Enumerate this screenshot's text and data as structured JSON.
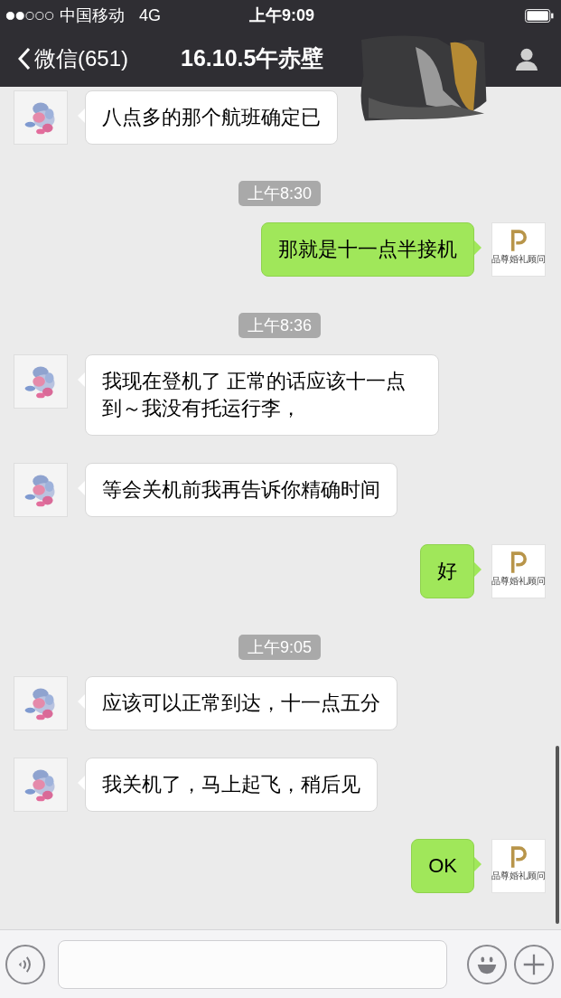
{
  "status_bar": {
    "carrier": "中国移动",
    "network": "4G",
    "time": "上午9:09"
  },
  "nav": {
    "back": "微信(651)",
    "title": "16.10.5午赤壁"
  },
  "messages": [
    {
      "kind": "received",
      "text": "八点多的那个航班确定已"
    },
    {
      "kind": "time",
      "text": "上午8:30"
    },
    {
      "kind": "sent",
      "text": "那就是十一点半接机",
      "avatar_logo": "品尊婚礼顾问"
    },
    {
      "kind": "time",
      "text": "上午8:36"
    },
    {
      "kind": "received",
      "text": "我现在登机了 正常的话应该十一点到～我没有托运行李，"
    },
    {
      "kind": "received",
      "text": "等会关机前我再告诉你精确时间"
    },
    {
      "kind": "sent",
      "text": "好",
      "avatar_logo": "品尊婚礼顾问"
    },
    {
      "kind": "time",
      "text": "上午9:05"
    },
    {
      "kind": "received",
      "text": "应该可以正常到达，十一点五分"
    },
    {
      "kind": "received",
      "text": "我关机了，马上起飞，稍后见"
    },
    {
      "kind": "sent",
      "text": "OK",
      "avatar_logo": "品尊婚礼顾问"
    }
  ]
}
